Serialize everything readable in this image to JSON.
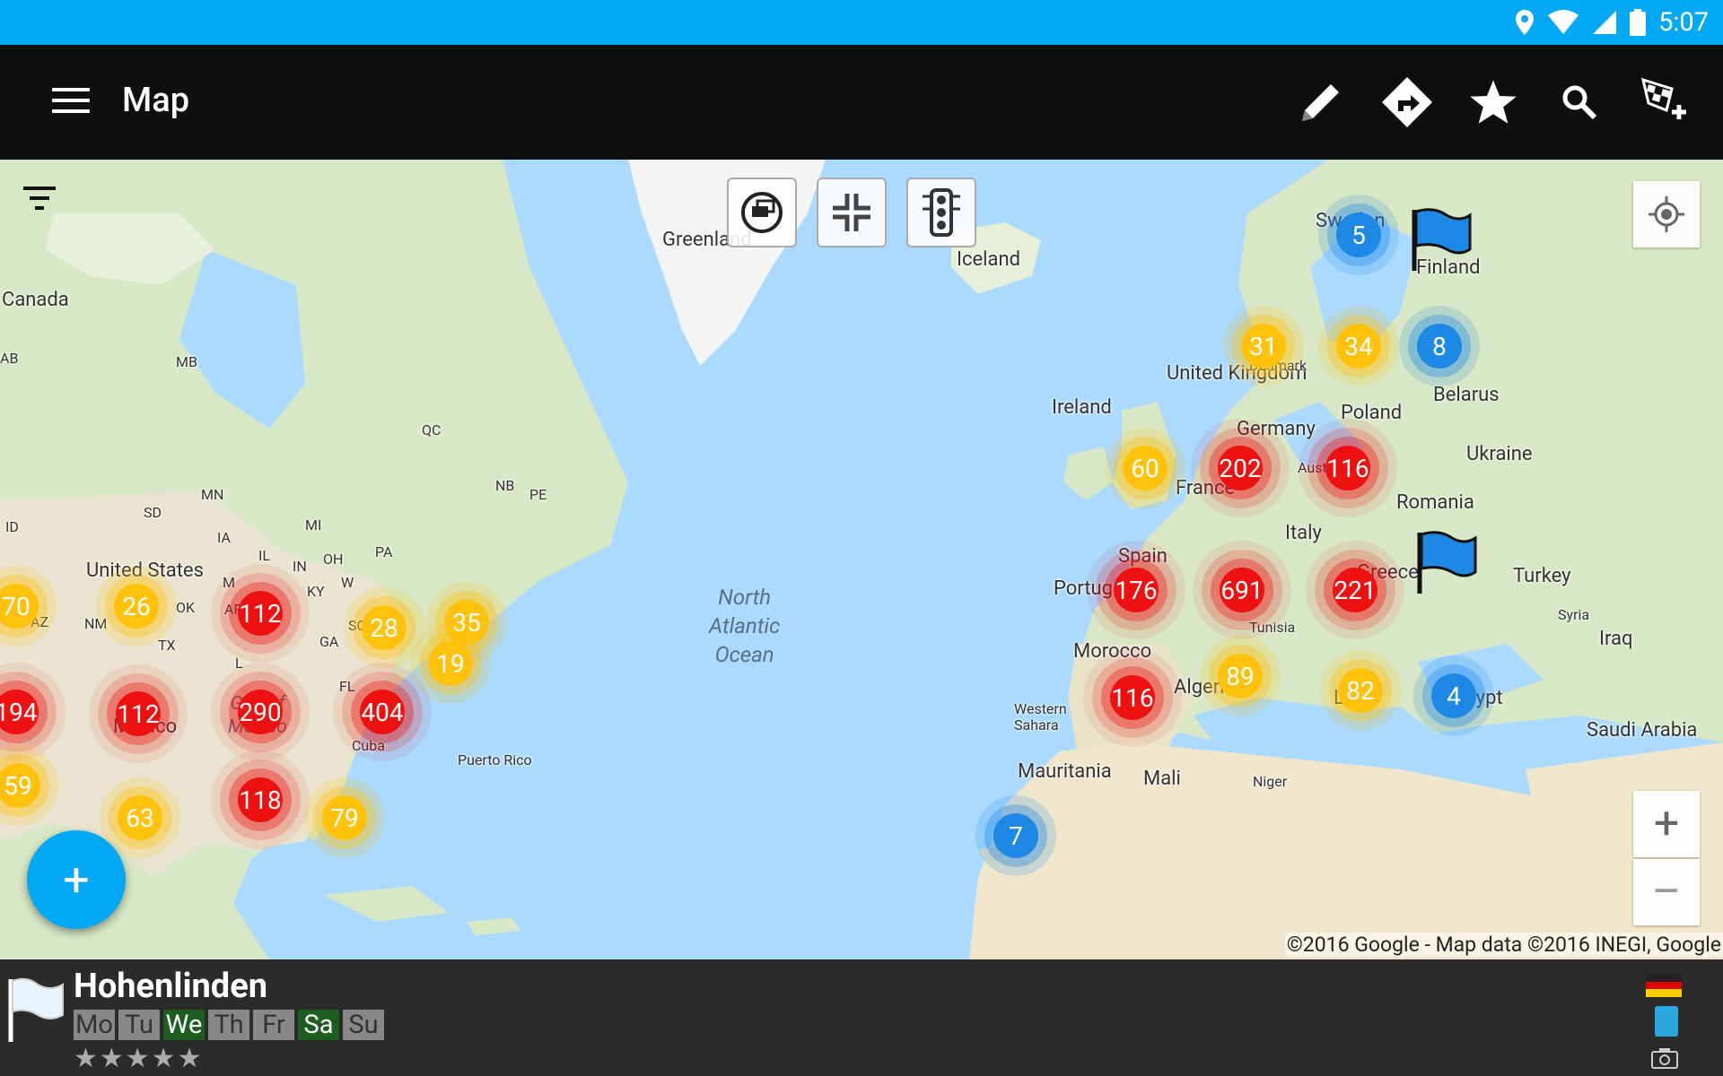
{
  "status_bar": {
    "time": "5:07",
    "icons": [
      "location-icon",
      "wifi-icon",
      "cell-signal-icon",
      "battery-icon"
    ]
  },
  "app_bar": {
    "title": "Map",
    "actions": [
      "edit-icon",
      "directions-icon",
      "favorite-star-icon",
      "search-icon",
      "add-checkered-flag-icon"
    ]
  },
  "map": {
    "labels": {
      "greenland": "Greenland",
      "iceland": "Iceland",
      "canada": "Canada",
      "sweden": "Sweden",
      "finland": "Finland",
      "ireland": "Ireland",
      "united_kingdom": "United Kingdom",
      "denmark": "Denmark",
      "belarus": "Belarus",
      "poland": "Poland",
      "germany": "Germany",
      "ukraine": "Ukraine",
      "austria": "Austria",
      "romania": "Romania",
      "france": "France",
      "italy": "Italy",
      "spain": "Spain",
      "portugal": "Portugal",
      "greece": "Greece",
      "turkey": "Turkey",
      "tunisia": "Tunisia",
      "syria": "Syria",
      "iraq": "Iraq",
      "morocco": "Morocco",
      "algeria": "Algeria",
      "libya": "Libya",
      "egypt": "Egypt",
      "saudi_arabia": "Saudi Arabia",
      "western_sahara": "Western\nSahara",
      "mauritania": "Mauritania",
      "mali": "Mali",
      "niger": "Niger",
      "ocean": "North\nAtlantic\nOcean",
      "gulf": "Gulf of\nMexico",
      "cuba": "Cuba",
      "puerto_rico": "Puerto Rico",
      "mexico": "Mexico",
      "united_states": "United States",
      "mb": "MB",
      "ab": "AB",
      "qc": "QC",
      "nb": "NB",
      "pe": "PE",
      "mn": "MN",
      "sd": "SD",
      "id": "ID",
      "mi": "MI",
      "ia": "IA",
      "il": "IL",
      "in": "IN",
      "oh": "OH",
      "pa": "PA",
      "ky": "KY",
      "ok": "OK",
      "ar": "AR",
      "az": "AZ",
      "nm": "NM",
      "tx": "TX",
      "ga": "GA",
      "sc": "SC",
      "fl": "FL",
      "wv": "W",
      "mo": "M",
      "la": "L"
    },
    "clusters": [
      {
        "count": "70",
        "color": "yellow"
      },
      {
        "count": "26",
        "color": "yellow"
      },
      {
        "count": "112",
        "color": "red"
      },
      {
        "count": "28",
        "color": "yellow"
      },
      {
        "count": "35",
        "color": "yellow"
      },
      {
        "count": "19",
        "color": "yellow"
      },
      {
        "count": "194",
        "color": "red"
      },
      {
        "count": "112",
        "color": "red"
      },
      {
        "count": "290",
        "color": "red"
      },
      {
        "count": "404",
        "color": "red"
      },
      {
        "count": "59",
        "color": "yellow"
      },
      {
        "count": "63",
        "color": "yellow"
      },
      {
        "count": "118",
        "color": "red"
      },
      {
        "count": "79",
        "color": "yellow"
      },
      {
        "count": "7",
        "color": "blue"
      },
      {
        "count": "5",
        "color": "blue"
      },
      {
        "count": "31",
        "color": "yellow"
      },
      {
        "count": "34",
        "color": "yellow"
      },
      {
        "count": "8",
        "color": "blue"
      },
      {
        "count": "60",
        "color": "yellow"
      },
      {
        "count": "202",
        "color": "red"
      },
      {
        "count": "116",
        "color": "red"
      },
      {
        "count": "176",
        "color": "red"
      },
      {
        "count": "691",
        "color": "red"
      },
      {
        "count": "221",
        "color": "red"
      },
      {
        "count": "89",
        "color": "yellow"
      },
      {
        "count": "82",
        "color": "yellow"
      },
      {
        "count": "116",
        "color": "red"
      },
      {
        "count": "4",
        "color": "blue"
      }
    ],
    "copyright": "©2016 Google - Map data ©2016 INEGI, Google",
    "google_logo": "Google",
    "controls": [
      "hide-markers-icon",
      "compress-icon",
      "traffic-light-icon"
    ],
    "zoom_in": "+",
    "fab": "+",
    "colors": {
      "red": "#ee1111",
      "yellow": "#ffc10a",
      "blue": "#1e88e5",
      "accent": "#03a9f4"
    }
  },
  "bottom_panel": {
    "name": "Hohenlinden",
    "days": [
      {
        "label": "Mo",
        "open": false
      },
      {
        "label": "Tu",
        "open": false
      },
      {
        "label": "We",
        "open": true
      },
      {
        "label": "Th",
        "open": false
      },
      {
        "label": "Fr",
        "open": false
      },
      {
        "label": "Sa",
        "open": true
      },
      {
        "label": "Su",
        "open": false
      }
    ],
    "rating": "0 of 5",
    "stars": "★★★★★"
  }
}
